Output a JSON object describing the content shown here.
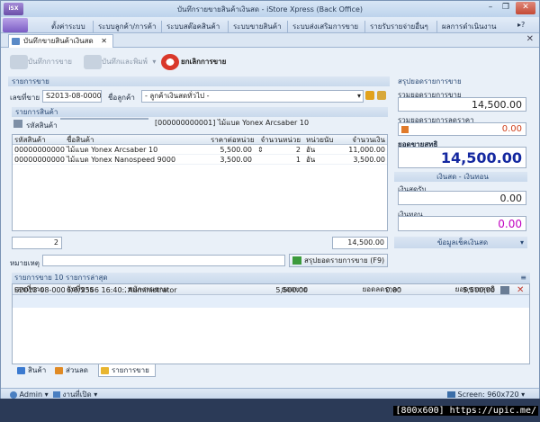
{
  "window": {
    "title": "บันทึกรายขายสินค้าเงินสด - iStore Xpress (Back Office)",
    "app_logo": "iSX"
  },
  "menu": [
    "ตั้งค่าระบบ",
    "ระบบลูกค้า/การค้า",
    "ระบบสต๊อคสินค้า",
    "ระบบขายสินค้า",
    "ระบบส่งเสริมการขาย",
    "รายรับรายจ่ายอื่นๆ",
    "ผลการดำเนินงาน"
  ],
  "doc_tab": "บันทึกขายสินค้าเงินสด",
  "toolbar": {
    "save": "บันทึกการขาย",
    "save_print": "บันทึกและพิมพ์",
    "cancel": "ยกเลิกการขาย"
  },
  "sale": {
    "section": "รายการขาย",
    "doc_no_label": "เลขที่ขาย",
    "doc_no": "S2013-08-000002",
    "customer_label": "ชื่อลูกค้า",
    "customer": "- ลูกค้าเงินสดทั่วไป -"
  },
  "items": {
    "section": "รายการสินค้า",
    "code_label": "รหัสสินค้า",
    "code_value": "",
    "lookup_text": "[000000000001] ไม้แบด Yonex Arcsaber 10",
    "columns": [
      "รหัสสินค้า",
      "ชื่อสินค้า",
      "ราคาต่อหน่วย",
      "จำนวนหน่วย",
      "หน่วยนับ",
      "จำนวนเงิน"
    ],
    "rows": [
      [
        "000000000001",
        "ไม้แบด Yonex Arcsaber 10",
        "5,500.00",
        "2",
        "อัน",
        "11,000.00"
      ],
      [
        "000000000002",
        "ไม้แบด Yonex Nanospeed 9000",
        "3,500.00",
        "1",
        "อัน",
        "3,500.00"
      ]
    ],
    "total_qty": "2",
    "total_amount": "14,500.00"
  },
  "note_label": "หมายเหตุ",
  "summary_button": "สรุปยอดรายการขาย (F9)",
  "summary": {
    "title": "สรุปยอดรายการขาย",
    "gross_label": "รวมยอดรายการขาย",
    "gross": "14,500.00",
    "discount_label": "รวมยอดรายการลดราคา",
    "discount": "0.00",
    "net_label": "ยอดขายสุทธิ",
    "net": "14,500.00",
    "cash_section": "เงินสด - เงินทอน",
    "received_label": "เงินสดรับ",
    "received": "0.00",
    "change_label": "เงินทอน",
    "change": "0.00",
    "more": "ข้อมูลเช็คเงินสด"
  },
  "recent": {
    "title": "รายการขาย 10 รายการล่าสุด",
    "columns": [
      "เลขที่ขาย",
      "วันที่ขาย",
      "พนักงานขาย",
      "ยอดขาย",
      "ยอดลดราคา",
      "ยอดขายสุทธิ"
    ],
    "rows": [
      [
        "S2013-08-000001",
        "6/8/2556 16:40:29",
        "Administrator",
        "5,500.00",
        "0.00",
        "5,500.00"
      ]
    ]
  },
  "bottom_tabs": [
    "สินค้า",
    "ส่วนลด",
    "รายการขาย"
  ],
  "status": {
    "user": "Admin",
    "open": "งานที่เปิด",
    "screen": "Screen: 960x720"
  },
  "watermark": "[800x600] https://upic.me/",
  "colors": {
    "accent": "#2b4a75",
    "net_text": "#1428a0",
    "change_text": "#c000c0",
    "discount_text": "#d0401c"
  }
}
